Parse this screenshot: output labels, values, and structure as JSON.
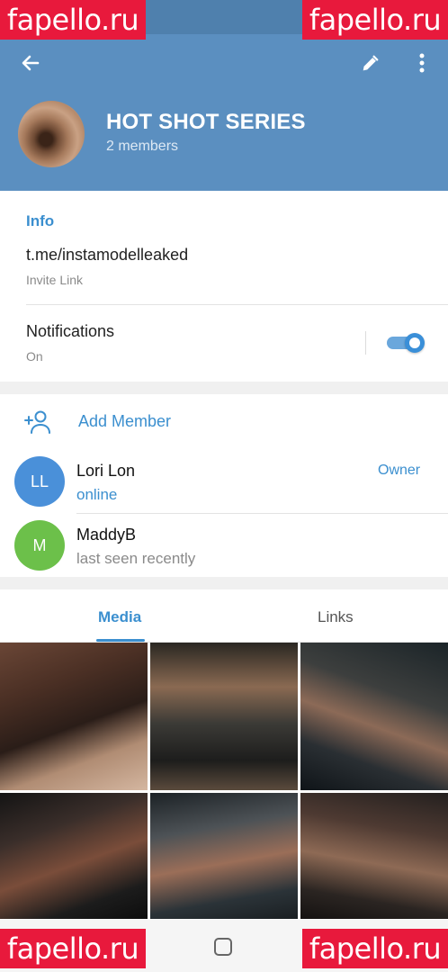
{
  "header": {
    "title": "HOT SHOT SERIES",
    "subtitle": "2 members"
  },
  "info": {
    "section_title": "Info",
    "link": "t.me/instamodelleaked",
    "link_label": "Invite Link",
    "notifications_label": "Notifications",
    "notifications_value": "On",
    "notifications_on": true
  },
  "members": {
    "add_label": "Add Member",
    "list": [
      {
        "initials": "LL",
        "name": "Lori Lon",
        "status": "online",
        "role": "Owner",
        "color": "#4a90d9"
      },
      {
        "initials": "M",
        "name": "MaddyB",
        "status": "last seen recently",
        "role": "",
        "color": "#6cc04a"
      }
    ]
  },
  "tabs": [
    {
      "label": "Media",
      "active": true
    },
    {
      "label": "Links",
      "active": false
    }
  ],
  "watermark": "fapello.ru",
  "colors": {
    "header": "#5b8fc0",
    "accent": "#3b8fcf",
    "watermark": "#e8193c"
  },
  "icons": [
    "back-arrow-icon",
    "pencil-icon",
    "more-vert-icon",
    "add-person-icon",
    "home-icon"
  ]
}
